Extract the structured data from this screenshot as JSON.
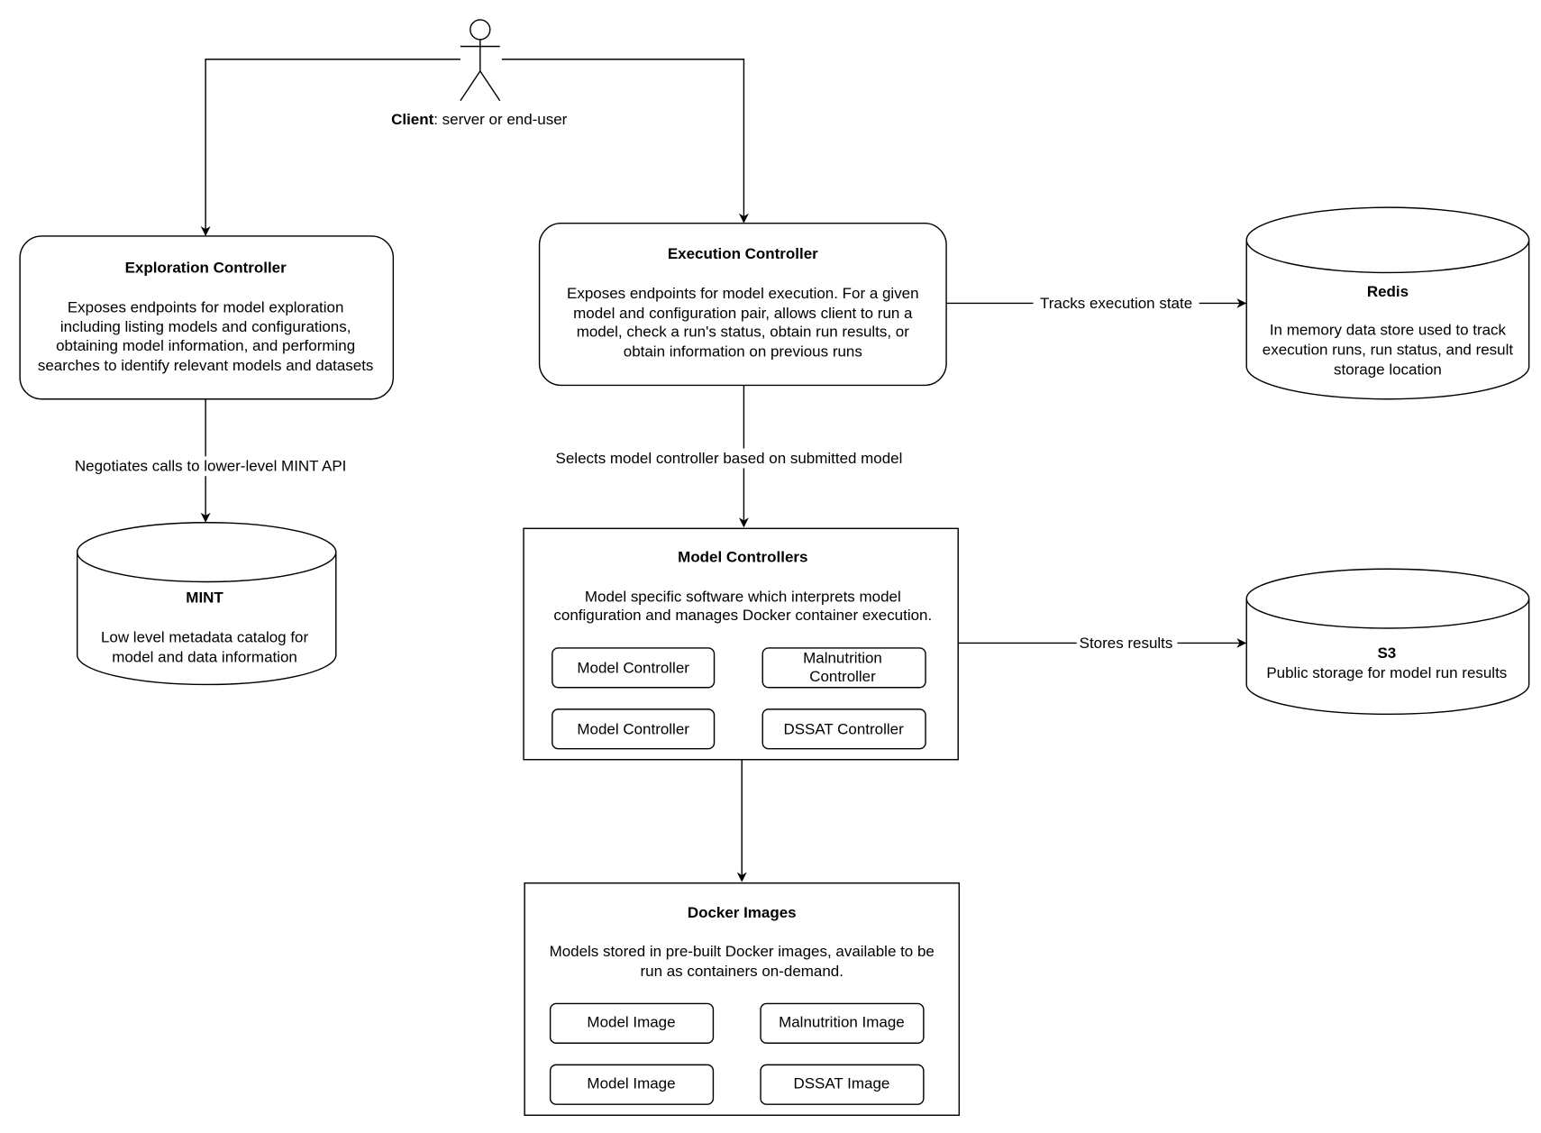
{
  "actor": {
    "name_bold": "Client",
    "name_rest": ": server or end-user"
  },
  "exploration": {
    "title": "Exploration Controller",
    "lines": [
      "Exposes endpoints for model exploration",
      "including listing models and configurations,",
      "obtaining model information, and performing",
      "searches to identify relevant models and datasets"
    ]
  },
  "execution": {
    "title": "Execution Controller",
    "lines": [
      "Exposes endpoints for model execution. For a given",
      "model and configuration pair, allows client to run a",
      "model, check a run's status, obtain run results, or",
      "obtain information on previous runs"
    ]
  },
  "redis": {
    "title": "Redis",
    "lines": [
      "In memory data store used to track",
      "execution runs, run status, and result",
      "storage location"
    ]
  },
  "mint": {
    "title": "MINT",
    "lines": [
      "Low level metadata catalog for",
      "model and data information"
    ]
  },
  "s3": {
    "title": "S3",
    "lines": [
      "Public storage for model run results"
    ]
  },
  "model_controllers": {
    "title": "Model Controllers",
    "lines": [
      "Model specific software which interprets model",
      "configuration and manages Docker container execution."
    ],
    "items": [
      [
        "Model Controller"
      ],
      [
        "Malnutrition",
        "Controller"
      ],
      [
        "Model Controller"
      ],
      [
        "DSSAT Controller"
      ]
    ]
  },
  "docker_images": {
    "title": "Docker Images",
    "lines": [
      "Models stored in pre-built Docker images, available to be",
      "run as containers on-demand."
    ],
    "items": [
      "Model Image",
      "Malnutrition Image",
      "Model Image",
      "DSSAT Image"
    ]
  },
  "edges": {
    "tracks": "Tracks execution state",
    "selects": "Selects model controller based on submitted model",
    "negotiates": "Negotiates calls to lower-level MINT API",
    "stores": "Stores results"
  }
}
